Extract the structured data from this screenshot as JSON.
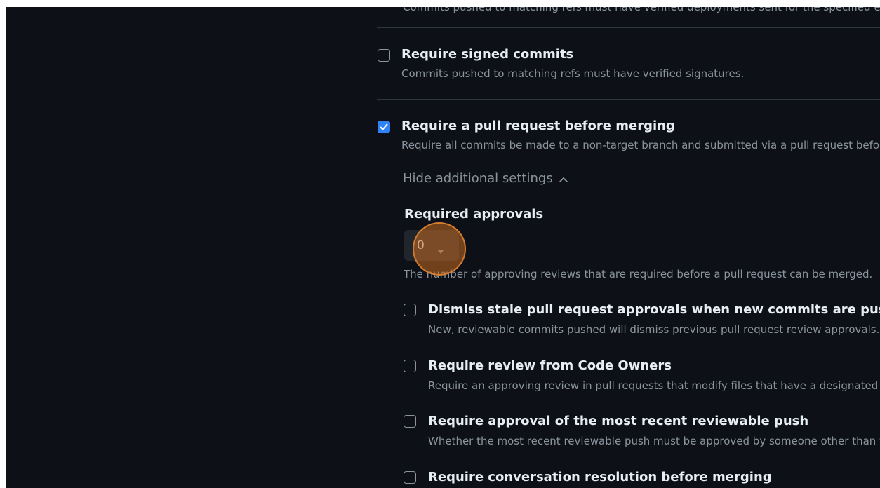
{
  "top_fragment": "Commits pushed to matching refs must have verified deployments sent for the specified environments to pass",
  "signed_commits": {
    "title": "Require signed commits",
    "desc": "Commits pushed to matching refs must have verified signatures.",
    "checked": false
  },
  "pull_request": {
    "title": "Require a pull request before merging",
    "desc": "Require all commits be made to a non-target branch and submitted via a pull request before they can be merged.",
    "checked": true
  },
  "toggle_label": "Hide additional settings",
  "required_approvals": {
    "label": "Required approvals",
    "value": "0",
    "help": "The number of approving reviews that are required before a pull request can be merged."
  },
  "sub_options": [
    {
      "title": "Dismiss stale pull request approvals when new commits are pushed",
      "desc": "New, reviewable commits pushed will dismiss previous pull request review approvals.",
      "checked": false
    },
    {
      "title": "Require review from Code Owners",
      "desc": "Require an approving review in pull requests that modify files that have a designated code owner.",
      "checked": false
    },
    {
      "title": "Require approval of the most recent reviewable push",
      "desc": "Whether the most recent reviewable push must be approved by someone other than the person who pushed it.",
      "checked": false
    },
    {
      "title": "Require conversation resolution before merging",
      "desc": "",
      "checked": false
    }
  ],
  "colors": {
    "background": "#0d1117",
    "accent": "#2f81f7",
    "click_marker": "#c46a20"
  },
  "icons": {
    "check": "checkmark-icon",
    "chevron": "chevron-up-icon",
    "caret": "caret-down-icon"
  }
}
